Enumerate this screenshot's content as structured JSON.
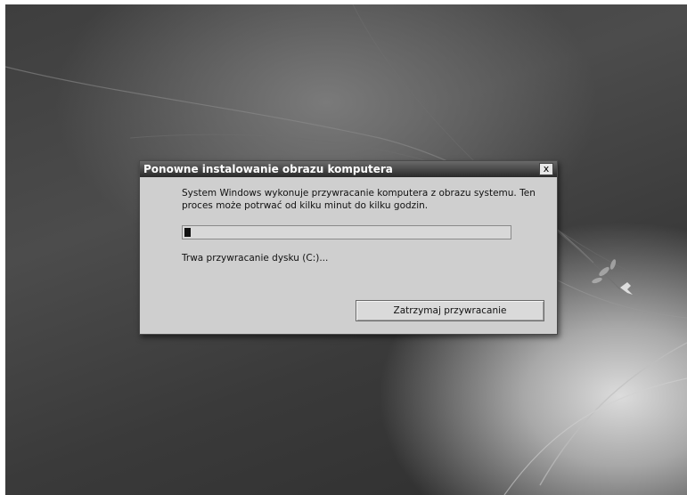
{
  "dialog": {
    "title": "Ponowne instalowanie obrazu komputera",
    "close_label": "x",
    "message_line1": "System Windows wykonuje przywracanie komputera z obrazu systemu. Ten",
    "message_line2": "proces może potrwać od kilku minut do kilku godzin.",
    "progress": 0.02,
    "status": "Trwa przywracanie dysku (C:)...",
    "stop_button_label": "Zatrzymaj przywracanie"
  },
  "colors": {
    "titlebar": "#2a2a2a",
    "dialog_background": "#cfcfcf",
    "progress_fill": "#111111"
  },
  "icons": {
    "close": "close-icon",
    "bird": "bird-icon"
  }
}
